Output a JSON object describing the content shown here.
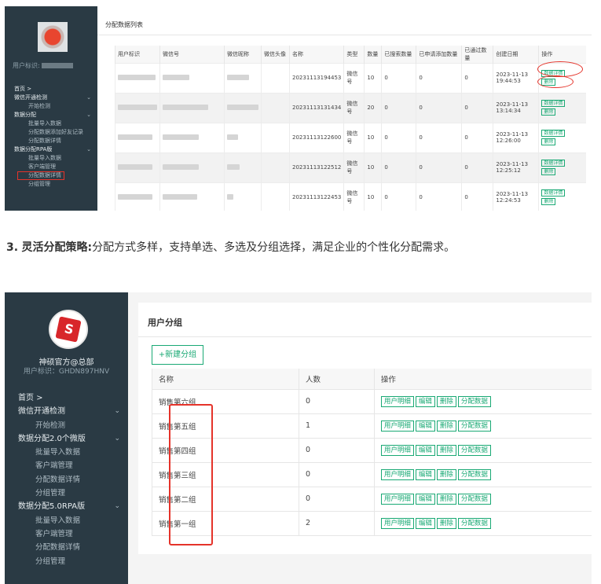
{
  "shot1": {
    "sidebar": {
      "uid_label": "用户标识:",
      "nav": [
        {
          "label": "首页 >",
          "sub": false,
          "chev": ""
        },
        {
          "label": "微信开通检测",
          "sub": false,
          "chev": "⌄"
        },
        {
          "label": "开始检测",
          "sub": true,
          "chev": ""
        },
        {
          "label": "数据分配",
          "sub": false,
          "chev": "⌄"
        },
        {
          "label": "批量导入数据",
          "sub": true,
          "chev": ""
        },
        {
          "label": "分配数据添加好友记录",
          "sub": true,
          "chev": ""
        },
        {
          "label": "分配数据详情",
          "sub": true,
          "chev": ""
        },
        {
          "label": "数据分配RPA版",
          "sub": false,
          "chev": "⌄"
        },
        {
          "label": "批量导入数据",
          "sub": true,
          "chev": ""
        },
        {
          "label": "客户端管理",
          "sub": true,
          "chev": ""
        },
        {
          "label": "分配数据详情",
          "sub": true,
          "chev": "",
          "highlight": true
        },
        {
          "label": "分组管理",
          "sub": true,
          "chev": ""
        }
      ]
    },
    "title": "分配数据列表",
    "columns": [
      "用户标识",
      "微信号",
      "微信昵称",
      "微信头像",
      "名称",
      "类型",
      "数量",
      "已搜索数量",
      "已申请添加数量",
      "已通过数量",
      "创建日期",
      "操作"
    ],
    "rows": [
      {
        "name": "20231113194453",
        "type": "微信号",
        "qty": "10",
        "searched": "0",
        "applied": "0",
        "passed": "0",
        "date": "2023-11-13",
        "time": "19:44:53"
      },
      {
        "name": "20231113131434",
        "type": "微信号",
        "qty": "20",
        "searched": "0",
        "applied": "0",
        "passed": "0",
        "date": "2023-11-13",
        "time": "13:14:34"
      },
      {
        "name": "20231113122600",
        "type": "微信号",
        "qty": "10",
        "searched": "0",
        "applied": "0",
        "passed": "0",
        "date": "2023-11-13",
        "time": "12:26:00"
      },
      {
        "name": "20231113122512",
        "type": "微信号",
        "qty": "10",
        "searched": "0",
        "applied": "0",
        "passed": "0",
        "date": "2023-11-13",
        "time": "12:25:12"
      },
      {
        "name": "20231113122453",
        "type": "微信号",
        "qty": "10",
        "searched": "0",
        "applied": "0",
        "passed": "0",
        "date": "2023-11-13",
        "time": "12:24:53"
      }
    ],
    "op_detail": "数据详情",
    "op_delete": "删除"
  },
  "caption": {
    "number": "3.",
    "bold": "灵活分配策略:",
    "text": "分配方式多样，支持单选、多选及分组选择，满足企业的个性化分配需求。"
  },
  "shot2": {
    "sidebar": {
      "org_name": "神硕官方@总部",
      "uid": "用户标识：GHDN897HNV",
      "nav": [
        {
          "label": "首页 >",
          "sub": false,
          "chev": ""
        },
        {
          "label": "微信开通检测",
          "sub": false,
          "chev": "⌄"
        },
        {
          "label": "开始检测",
          "sub": true,
          "chev": ""
        },
        {
          "label": "数据分配2.0个微版",
          "sub": false,
          "chev": "⌄"
        },
        {
          "label": "批量导入数据",
          "sub": true,
          "chev": ""
        },
        {
          "label": "客户端管理",
          "sub": true,
          "chev": ""
        },
        {
          "label": "分配数据详情",
          "sub": true,
          "chev": ""
        },
        {
          "label": "分组管理",
          "sub": true,
          "chev": ""
        },
        {
          "label": "数据分配5.0RPA版",
          "sub": false,
          "chev": "⌄"
        },
        {
          "label": "批量导入数据",
          "sub": true,
          "chev": ""
        },
        {
          "label": "客户端管理",
          "sub": true,
          "chev": ""
        },
        {
          "label": "分配数据详情",
          "sub": true,
          "chev": ""
        },
        {
          "label": "分组管理",
          "sub": true,
          "chev": ""
        }
      ]
    },
    "title": "用户分组",
    "new_button": "+新建分组",
    "columns": [
      "名称",
      "人数",
      "操作"
    ],
    "rows": [
      {
        "name": "销售第六组",
        "count": "0"
      },
      {
        "name": "销售第五组",
        "count": "1"
      },
      {
        "name": "销售第四组",
        "count": "0"
      },
      {
        "name": "销售第三组",
        "count": "0"
      },
      {
        "name": "销售第二组",
        "count": "0"
      },
      {
        "name": "销售第一组",
        "count": "2"
      }
    ],
    "ops": [
      "用户明细",
      "编辑",
      "删除",
      "分配数据"
    ]
  }
}
